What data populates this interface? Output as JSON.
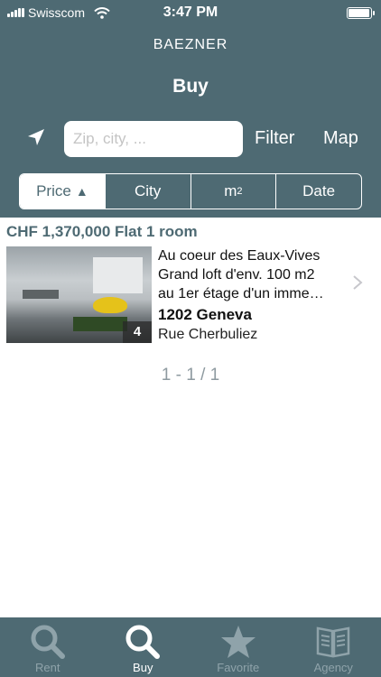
{
  "status_bar": {
    "carrier": "Swisscom",
    "time": "3:47 PM",
    "battery_level": 0.95
  },
  "header": {
    "brand": "BAEZNER",
    "title": "Buy"
  },
  "toolbar": {
    "search_placeholder": "Zip, city, ...",
    "filter_label": "Filter",
    "map_label": "Map",
    "location_icon": "location-arrow-icon"
  },
  "sort": {
    "options": [
      {
        "label": "Price",
        "indicator": "▲",
        "active": true
      },
      {
        "label": "City"
      },
      {
        "label": "m",
        "superscript": "2"
      },
      {
        "label": "Date"
      }
    ]
  },
  "listings": [
    {
      "title": "CHF 1,370,000 Flat 1 room",
      "photo_count": "4",
      "description_lines": [
        "Au coeur des Eaux-Vives",
        "Grand loft d'env. 100 m2",
        "au 1er étage d'un imme…"
      ],
      "city": "1202 Geneva",
      "street": "Rue Cherbuliez"
    }
  ],
  "pager": "1 - 1 / 1",
  "tabbar": {
    "tabs": [
      {
        "label": "Rent",
        "icon": "search-icon",
        "active": false
      },
      {
        "label": "Buy",
        "icon": "search-icon",
        "active": true
      },
      {
        "label": "Favorite",
        "icon": "star-icon",
        "active": false
      },
      {
        "label": "Agency",
        "icon": "book-icon",
        "active": false
      }
    ]
  },
  "colors": {
    "brand": "#4e6a73",
    "inactive_tab": "#8fa3aa",
    "background": "#ffffff"
  }
}
